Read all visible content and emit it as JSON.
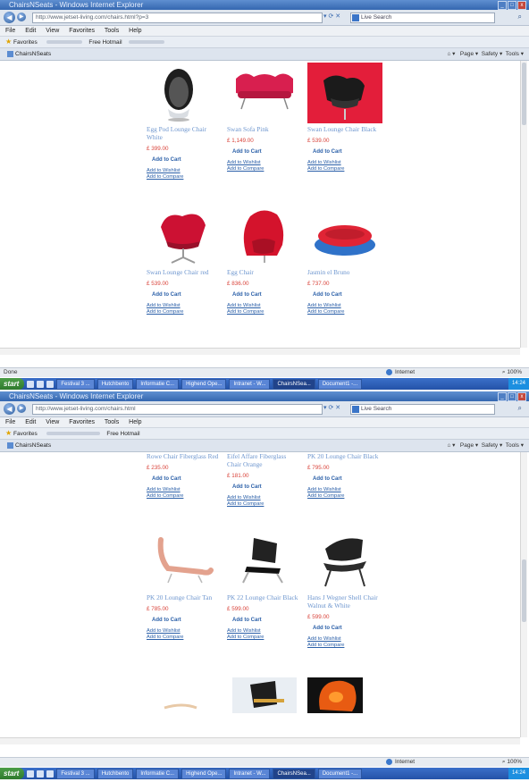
{
  "browser": {
    "title": "ChairsNSeats - Windows Internet Explorer",
    "url_top": "http://www.jetset-living.com/chairs.html?p=3",
    "url_bottom": "http://www.jetset-living.com/chairs.html",
    "search_placeholder": "Live Search",
    "menu": [
      "File",
      "Edit",
      "View",
      "Favorites",
      "Tools",
      "Help"
    ],
    "favorites_label": "Favorites",
    "free_hotmail": "Free Hotmail",
    "tab_title": "ChairsNSeats",
    "command_bar": [
      "Page ▾",
      "Safety ▾",
      "Tools ▾"
    ],
    "status_text": "Done",
    "zone": "Internet",
    "zoom": "100%"
  },
  "taskbar": {
    "start_label": "start",
    "items": [
      "Festival 3 ...",
      "Hutchbento",
      "Informatie C...",
      "Highend Ope...",
      "Intranet - W...",
      "ChairsNSea...",
      "Document1 -..."
    ],
    "active_index": 5,
    "clock": "14:24"
  },
  "labels": {
    "add_to_cart": "Add to Cart",
    "add_to_wishlist": "Add to Wishlist",
    "add_to_compare": "Add to Compare"
  },
  "top_products": [
    {
      "name": "Egg Pod Lounge Chair White",
      "price": "£ 399.00",
      "icon": "egg-pod-chair-icon"
    },
    {
      "name": "Swan Sofa Pink",
      "price": "£ 1,149.00",
      "icon": "swan-sofa-icon"
    },
    {
      "name": "Swan Lounge Chair Black",
      "price": "£ 539.00",
      "icon": "swan-lounge-black-icon"
    },
    {
      "name": "Swan Lounge Chair red",
      "price": "£ 539.00",
      "icon": "swan-chair-red-icon"
    },
    {
      "name": "Egg Chair",
      "price": "£ 836.00",
      "icon": "egg-chair-icon"
    },
    {
      "name": "Jasmin el Bruno",
      "price": "£ 737.00",
      "icon": "pebble-sofa-icon"
    }
  ],
  "bottom_products": [
    {
      "name": "Rowe Chair Fiberglass Red",
      "price": "£ 235.00",
      "icon": "rowe-chair-icon"
    },
    {
      "name": "Eifel Affare Fiberglass Chair Orange",
      "price": "£ 181.00",
      "icon": "eifel-chair-icon"
    },
    {
      "name": "PK 20 Lounge Chair Black",
      "price": "£ 795.00",
      "icon": "pk20-chair-icon"
    },
    {
      "name": "PK 20 Lounge Chair Tan",
      "price": "£ 785.00",
      "icon": "pk20-tan-chair-icon"
    },
    {
      "name": "PK 22 Lounge Chair Black",
      "price": "£ 599.00",
      "icon": "pk22-chair-icon"
    },
    {
      "name": "Hans J Wegner Shell Chair Walnut & White",
      "price": "£ 599.00",
      "icon": "shell-chair-icon"
    },
    {
      "name": "",
      "price": "",
      "icon": "partial-chair-icon"
    },
    {
      "name": "",
      "price": "",
      "icon": "partial-chair-icon"
    },
    {
      "name": "",
      "price": "",
      "icon": "partial-chair-icon"
    }
  ],
  "colors": {
    "link": "#2a5fa8",
    "product_name": "#6f97cf",
    "price": "#d9433a",
    "titlebar": "#3467b0"
  }
}
